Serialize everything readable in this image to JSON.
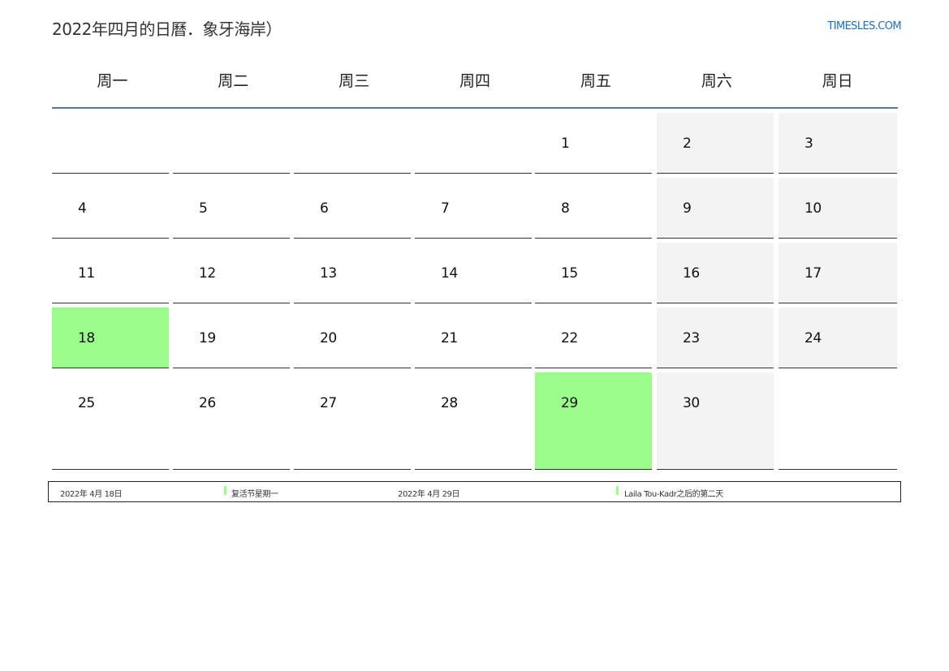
{
  "header": {
    "title": "2022年四月的日曆．象牙海岸）",
    "site": "TIMESLES.COM"
  },
  "weekdays": [
    "周一",
    "周二",
    "周三",
    "周四",
    "周五",
    "周六",
    "周日"
  ],
  "weeks": [
    [
      "",
      "",
      "",
      "",
      "1",
      "2",
      "3"
    ],
    [
      "4",
      "5",
      "6",
      "7",
      "8",
      "9",
      "10"
    ],
    [
      "11",
      "12",
      "13",
      "14",
      "15",
      "16",
      "17"
    ],
    [
      "18",
      "19",
      "20",
      "21",
      "22",
      "23",
      "24"
    ],
    [
      "25",
      "26",
      "27",
      "28",
      "29",
      "30",
      ""
    ]
  ],
  "colors": {
    "holiday": "#9cfc8b",
    "weekend": "#f3f3f3",
    "header_rule": "#5a7899",
    "site_link": "#1f6fb8"
  },
  "legend": [
    {
      "date": "2022年 4月 18日",
      "name": "复活节星期一"
    },
    {
      "date": "2022年 4月 29日",
      "name": "Laila Tou-Kadr之后的第二天"
    }
  ]
}
